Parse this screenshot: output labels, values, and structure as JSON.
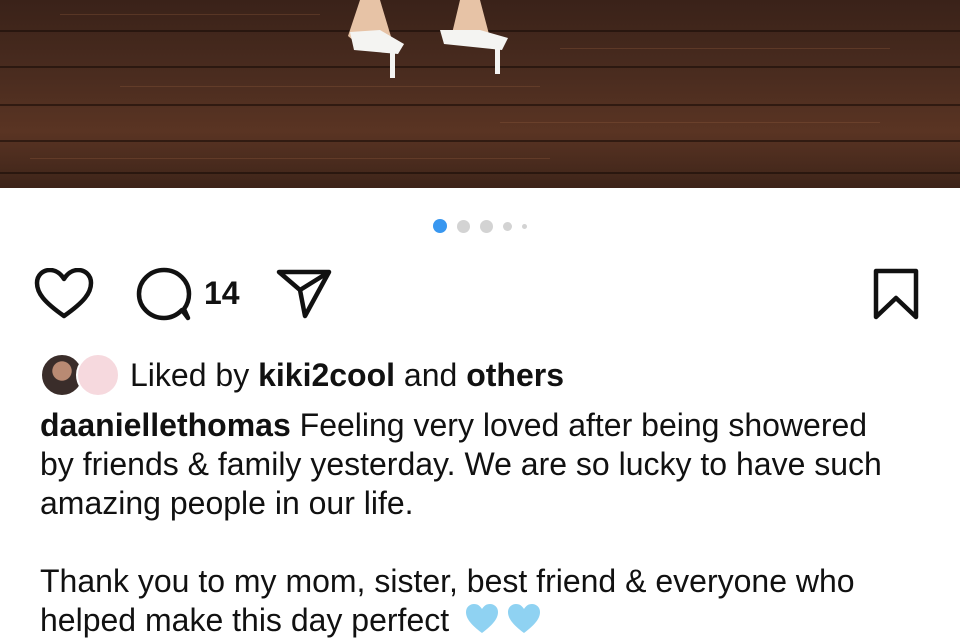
{
  "post": {
    "carousel": {
      "slide_count": 5,
      "active_index": 0
    },
    "actions": {
      "like_icon": "heart-outline-icon",
      "comment_icon": "comment-bubble-icon",
      "comment_count": "14",
      "share_icon": "paper-plane-icon",
      "save_icon": "bookmark-icon"
    },
    "likes": {
      "prefix": "Liked by",
      "user": "kiki2cool",
      "joiner": "and",
      "others": "others"
    },
    "caption": {
      "username": "daaniellethomas",
      "text_1": " Feeling very loved after being showered by friends & family yesterday. We are so lucky to have such amazing people in our life.",
      "text_2": "Thank you to my mom, sister, best friend & everyone who helped make this day perfect",
      "emojis": [
        "light-blue-heart",
        "light-blue-heart"
      ]
    }
  },
  "colors": {
    "active_dot": "#3897f0",
    "inactive_dot": "#d3d3d3",
    "heart_emoji": "#8fd2f2"
  }
}
